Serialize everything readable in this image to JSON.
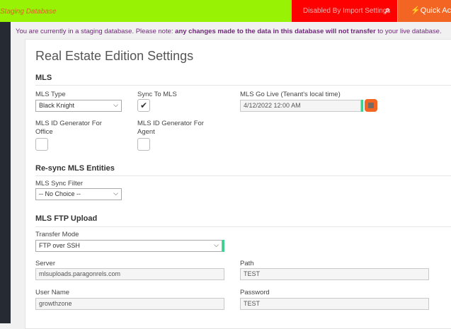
{
  "topbar": {
    "staging": "Staging Database",
    "disabled": "Disabled By Import Settings",
    "quick": "Quick Actions",
    "colors": {
      "bar": "#97f203",
      "disabled": "#ff0000",
      "quick": "#f26522"
    }
  },
  "notice": {
    "pre": "You are currently in a staging database. Please note: ",
    "bold": "any changes made to the data in this database will not transfer",
    "post": " to your live database."
  },
  "page_title": "Real Estate Edition Settings",
  "mls": {
    "heading": "MLS",
    "type_label": "MLS Type",
    "type_value": "Black Knight",
    "sync_label": "Sync To MLS",
    "sync_checked": true,
    "golive_label": "MLS Go Live (Tenant's local time)",
    "golive_value": "4/12/2022 12:00 AM",
    "office_label": "MLS ID Generator For Office",
    "agent_label": "MLS ID Generator For Agent"
  },
  "resync": {
    "heading": "Re-sync MLS Entities",
    "filter_label": "MLS Sync Filter",
    "filter_value": "-- No Choice --"
  },
  "ftp": {
    "heading": "MLS FTP Upload",
    "mode_label": "Transfer Mode",
    "mode_value": "FTP over SSH",
    "server_label": "Server",
    "server_value": "mlsuploads.paragonrels.com",
    "path_label": "Path",
    "path_value": "TEST",
    "user_label": "User Name",
    "user_value": "growthzone",
    "pass_label": "Password",
    "pass_value": "TEST"
  }
}
